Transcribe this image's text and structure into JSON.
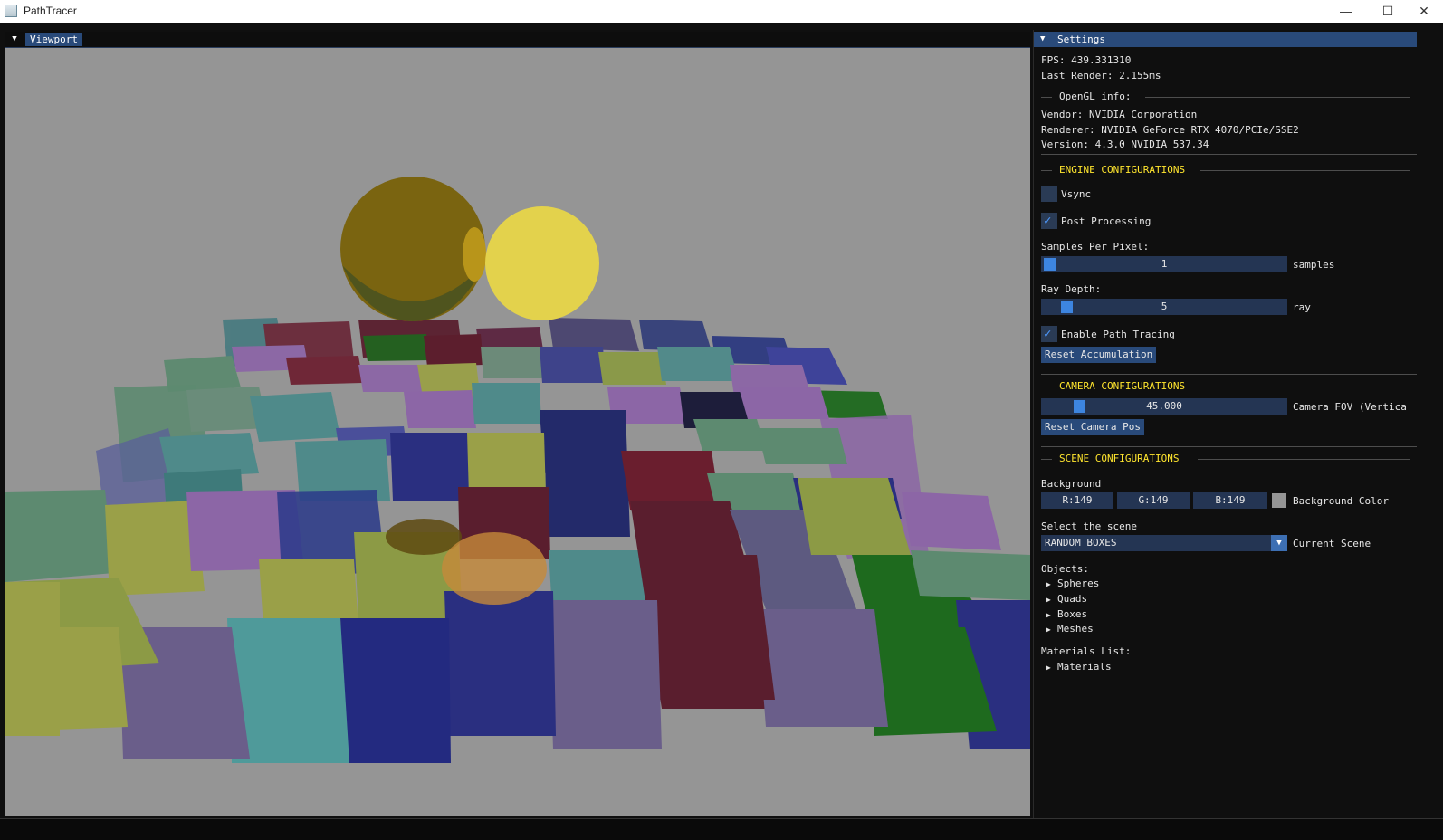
{
  "window": {
    "title": "PathTracer",
    "min_glyph": "—",
    "max_glyph": "☐",
    "close_glyph": "✕"
  },
  "viewport": {
    "tab_label": "Viewport",
    "background_color": "#959595"
  },
  "settings": {
    "tab_label": "Settings",
    "fps": "FPS: 439.331310",
    "last_render": "Last Render: 2.155ms",
    "opengl_header": "OpenGL info:",
    "vendor": "Vendor: NVIDIA Corporation",
    "renderer": "Renderer: NVIDIA GeForce RTX 4070/PCIe/SSE2",
    "version": "Version: 4.3.0 NVIDIA 537.34",
    "engine_header": "ENGINE CONFIGURATIONS",
    "vsync": {
      "label": "Vsync",
      "checked": false
    },
    "post_processing": {
      "label": "Post Processing",
      "checked": true
    },
    "spp_label": "Samples Per Pixel:",
    "spp_value": "1",
    "spp_unit": "samples",
    "ray_depth_label": "Ray Depth:",
    "ray_depth_value": "5",
    "ray_depth_unit": "ray",
    "path_tracing": {
      "label": "Enable Path Tracing",
      "checked": true
    },
    "reset_accum": "Reset Accumulation",
    "camera_header": "CAMERA CONFIGURATIONS",
    "fov_value": "45.000",
    "fov_label": "Camera FOV (Vertica",
    "reset_camera": "Reset Camera Pos",
    "scene_header": "SCENE CONFIGURATIONS",
    "background_label": "Background",
    "bg_r": "R:149",
    "bg_g": "G:149",
    "bg_b": "B:149",
    "bg_color_label": "Background Color",
    "bg_swatch_color": "#959595",
    "select_scene_label": "Select the scene",
    "scene_value": "RANDOM BOXES",
    "current_scene_label": "Current Scene",
    "objects_label": "Objects:",
    "objects": [
      "Spheres",
      "Quads",
      "Boxes",
      "Meshes"
    ],
    "materials_list_label": "Materials List:",
    "materials_item": "Materials"
  },
  "accent_colors": {
    "header_blue": "#294a7a",
    "section_yellow": "#ffe52e",
    "check_blue": "#4e9aff"
  }
}
